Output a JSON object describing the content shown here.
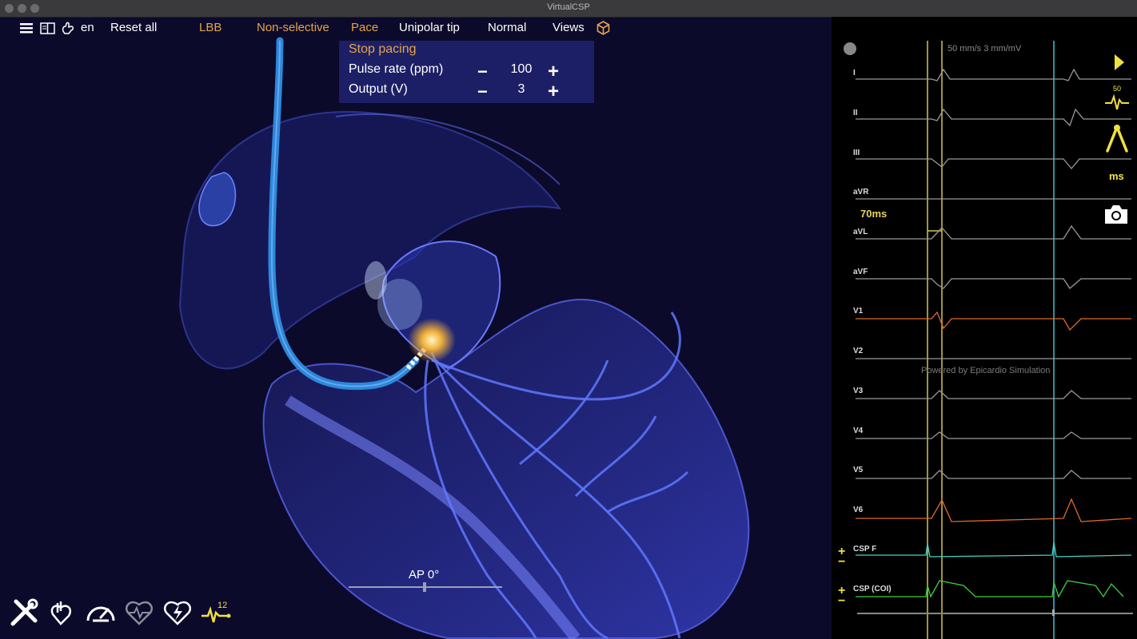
{
  "window": {
    "title": "VirtualCSP"
  },
  "menu": {
    "language": "en",
    "reset": "Reset all",
    "lbb": "LBB",
    "capture": "Non-selective",
    "pace": "Pace",
    "tip": "Unipolar tip",
    "mode": "Normal",
    "views": "Views"
  },
  "pacing": {
    "stop_label": "Stop pacing",
    "rate_label": "Pulse rate (ppm)",
    "rate_value": "100",
    "output_label": "Output (V)",
    "output_value": "3"
  },
  "view": {
    "angle_label": "AP 0°"
  },
  "ecg": {
    "speed_label": "50 mm/s  3 mm/mV",
    "interval_label": "70ms",
    "watermark": "Powered by Epicardio Simulation",
    "leads": [
      "I",
      "II",
      "III",
      "aVR",
      "aVL",
      "aVF",
      "V1",
      "V2",
      "V3",
      "V4",
      "V5",
      "V6",
      "CSP F",
      "CSP (COI)"
    ],
    "gain_badge": "50",
    "units_label": "ms"
  },
  "colors": {
    "accent": "#e7a34a",
    "caliper": "#d8c44a",
    "marker": "#3fc1d6",
    "orange_lead": "#e06a2a",
    "cyan_lead": "#3fd6c6",
    "green_lead": "#3ccf3c",
    "grey_lead": "#9a9a9a"
  },
  "icons": [
    "menu-icon",
    "book-icon",
    "hand-icon",
    "cube-icon",
    "tools-icon",
    "heart-hand-icon",
    "gauge-icon",
    "heart-rhythm-icon",
    "heart-shock-icon",
    "ecg12-icon",
    "play-icon",
    "zoom-ecg-icon",
    "caliper-icon",
    "camera-icon"
  ]
}
